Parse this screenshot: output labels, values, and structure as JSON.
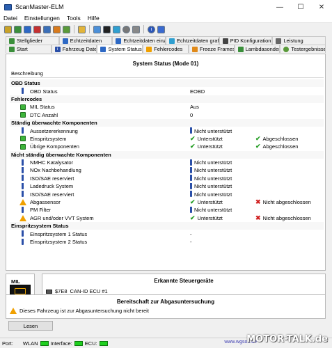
{
  "window": {
    "title": "ScanMaster-ELM"
  },
  "menu": {
    "items": [
      "Datei",
      "Einstellungen",
      "Tools",
      "Hilfe"
    ]
  },
  "tabs": {
    "row1": [
      "Stellglieder",
      "Echtzeitdaten",
      "Echtzeitdaten einzeln",
      "Echtzeitdaten grafisch",
      "PID Konfiguration",
      "Leistung"
    ],
    "row2": [
      "Start",
      "Fahrzeug Daten",
      "System Status",
      "Fehlercodes",
      "Freeze Frames",
      "Lambdasonden",
      "Testergebnisse"
    ],
    "active": "System Status"
  },
  "panel": {
    "title": "System Status (Mode 01)",
    "header": "Beschreibung",
    "rows": [
      {
        "type": "section",
        "label": "OBD Status"
      },
      {
        "type": "item",
        "icon": "info",
        "label": "OBD Status",
        "v1": "EOBD",
        "v1icon": "",
        "v2": "",
        "v2icon": ""
      },
      {
        "type": "section",
        "label": "Fehlercodes"
      },
      {
        "type": "item",
        "icon": "green",
        "label": "MIL Status",
        "v1": "Aus",
        "v1icon": "",
        "v2": "",
        "v2icon": ""
      },
      {
        "type": "item",
        "icon": "green",
        "label": "DTC Anzahl",
        "v1": "0",
        "v1icon": "",
        "v2": "",
        "v2icon": ""
      },
      {
        "type": "section",
        "label": "Ständig überwachte Komponenten"
      },
      {
        "type": "item",
        "icon": "info",
        "label": "Aussetzererkennung",
        "v1": "Nicht unterstützt",
        "v1icon": "info",
        "v2": "",
        "v2icon": ""
      },
      {
        "type": "item",
        "icon": "green",
        "label": "Einspritzsystem",
        "v1": "Unterstützt",
        "v1icon": "check",
        "v2": "Abgeschlossen",
        "v2icon": "check"
      },
      {
        "type": "item",
        "icon": "green",
        "label": "Übrige Komponenten",
        "v1": "Unterstützt",
        "v1icon": "check",
        "v2": "Abgeschlossen",
        "v2icon": "check"
      },
      {
        "type": "section",
        "label": "Nicht ständig überwachte Komponenten"
      },
      {
        "type": "item",
        "icon": "info",
        "label": "NMHC Katalysator",
        "v1": "Nicht unterstützt",
        "v1icon": "info",
        "v2": "",
        "v2icon": ""
      },
      {
        "type": "item",
        "icon": "info",
        "label": "NOx Nachbehandlung",
        "v1": "Nicht unterstützt",
        "v1icon": "info",
        "v2": "",
        "v2icon": ""
      },
      {
        "type": "item",
        "icon": "info",
        "label": "ISO/SAE reserviert",
        "v1": "Nicht unterstützt",
        "v1icon": "info",
        "v2": "",
        "v2icon": ""
      },
      {
        "type": "item",
        "icon": "info",
        "label": "Ladedruck System",
        "v1": "Nicht unterstützt",
        "v1icon": "info",
        "v2": "",
        "v2icon": ""
      },
      {
        "type": "item",
        "icon": "info",
        "label": "ISO/SAE reserviert",
        "v1": "Nicht unterstützt",
        "v1icon": "info",
        "v2": "",
        "v2icon": ""
      },
      {
        "type": "item",
        "icon": "warn",
        "label": "Abgassensor",
        "v1": "Unterstützt",
        "v1icon": "check",
        "v2": "Nicht abgeschlossen",
        "v2icon": "x"
      },
      {
        "type": "item",
        "icon": "info",
        "label": "PM Filter",
        "v1": "Nicht unterstützt",
        "v1icon": "info",
        "v2": "",
        "v2icon": ""
      },
      {
        "type": "item",
        "icon": "warn",
        "label": "AGR und/oder VVT System",
        "v1": "Unterstützt",
        "v1icon": "check",
        "v2": "Nicht abgeschlossen",
        "v2icon": "x"
      },
      {
        "type": "section",
        "label": "Einspritzsystem Status"
      },
      {
        "type": "item",
        "icon": "info",
        "label": "Einspritzsystem 1 Status",
        "v1": "-",
        "v1icon": "",
        "v2": "",
        "v2icon": ""
      },
      {
        "type": "item",
        "icon": "info",
        "label": "Einspritzsystem 2 Status",
        "v1": "-",
        "v1icon": "",
        "v2": "",
        "v2icon": ""
      }
    ]
  },
  "mil": {
    "label": "MIL"
  },
  "ecu": {
    "title": "Erkannte Steuergeräte",
    "entry_id": "$7E8",
    "entry_name": "CAN-ID ECU #1"
  },
  "readiness": {
    "title": "Bereitschaft zur Abgasuntersuchung",
    "message": "Dieses Fahrzeug ist zur Abgasuntersuchung nicht bereit"
  },
  "read_button": {
    "label": "Lesen"
  },
  "statusbar": {
    "port_label": "Port:",
    "wlan_label": "WLAN",
    "interface_label": "Interface:",
    "ecu_label": "ECU:"
  },
  "footer": {
    "site": "www.wgsoft.de",
    "watermark": "MOTOR-TALK.de"
  },
  "colors": {
    "ok_green": "#2aa02a",
    "error_red": "#d02020",
    "info_blue": "#2a4fa8",
    "warn_orange": "#f0a000",
    "led_green": "#1fcf1f"
  }
}
